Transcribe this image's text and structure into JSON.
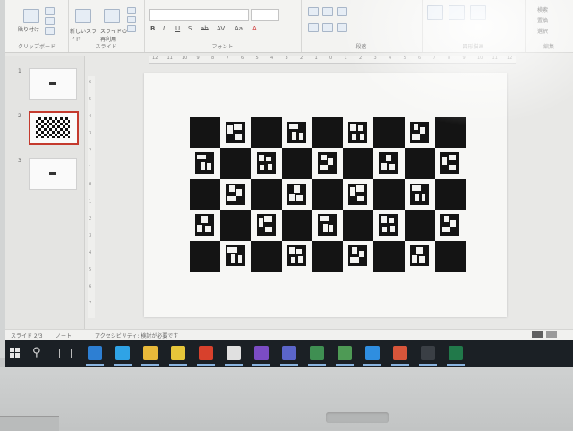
{
  "ribbon": {
    "group_labels": [
      "クリップボード",
      "スライド",
      "フォント",
      "段落",
      "図形描画",
      "編集"
    ],
    "font_name": "",
    "font_size": "",
    "format_buttons": [
      "B",
      "I",
      "U",
      "S",
      "ab",
      "AV",
      "Aa",
      "A"
    ],
    "slide_buttons": [
      "新しいスライド",
      "スライドの再利用"
    ],
    "paste_label": "貼り付け",
    "edit_items": [
      "検索",
      "置換",
      "選択"
    ]
  },
  "ruler_ticks": [
    "12",
    "11",
    "10",
    "9",
    "8",
    "7",
    "6",
    "5",
    "4",
    "3",
    "2",
    "1",
    "0",
    "1",
    "2",
    "3",
    "4",
    "5",
    "6",
    "7",
    "8",
    "9",
    "10",
    "11",
    "12"
  ],
  "slides_panel": {
    "slides": [
      {
        "number": "1",
        "content": "marker"
      },
      {
        "number": "2",
        "content": "checkerboard",
        "selected": true
      },
      {
        "number": "3",
        "content": "marker"
      }
    ]
  },
  "slide": {
    "board": {
      "rows": 5,
      "cols": 9,
      "pattern": "charuco",
      "colors": {
        "dark": "#141414",
        "light": "#f7f7f5"
      }
    }
  },
  "status_bar": {
    "slide_info": "スライド 2/3",
    "notes": "ノート",
    "accessibility": "アクセシビリティ: 検討が必要です"
  },
  "taskbar": {
    "apps": [
      {
        "name": "mail-icon",
        "color": "#2d7fd3"
      },
      {
        "name": "edge-icon",
        "color": "#2fa3e6"
      },
      {
        "name": "explorer-icon",
        "color": "#e8b93a"
      },
      {
        "name": "sticky-notes-icon",
        "color": "#e6c63a"
      },
      {
        "name": "acrobat-icon",
        "color": "#d8412c"
      },
      {
        "name": "chrome-icon",
        "color": "#e0e0e0"
      },
      {
        "name": "onenote-icon",
        "color": "#7b4cc4"
      },
      {
        "name": "teams-icon",
        "color": "#5b65c9"
      },
      {
        "name": "app-icon-green",
        "color": "#3f8f52"
      },
      {
        "name": "word-doc-icon",
        "color": "#4e9a55"
      },
      {
        "name": "vscode-icon",
        "color": "#2f8ee0"
      },
      {
        "name": "powerpoint-icon",
        "color": "#d7553a"
      },
      {
        "name": "terminal-icon",
        "color": "#3a3f45"
      },
      {
        "name": "excel-icon",
        "color": "#21794a"
      }
    ]
  }
}
